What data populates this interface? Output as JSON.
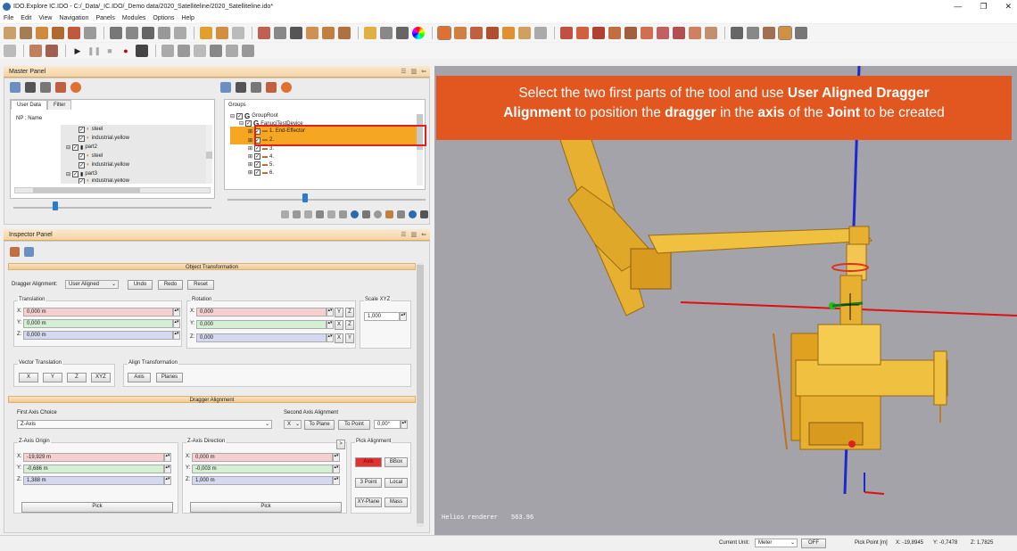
{
  "window": {
    "title": "IDO.Explore IC.IDO - C:/_Data/_IC.IDO/_Demo data/2020_Satelliteline/2020_Satelliteline.ido*",
    "minimize": "—",
    "restore": "❐",
    "close": "✕"
  },
  "menu": [
    "File",
    "Edit",
    "View",
    "Navigation",
    "Panels",
    "Modules",
    "Options",
    "Help"
  ],
  "master_panel": {
    "title": "Master Panel",
    "tabs": [
      "User Data",
      "Filter"
    ],
    "np_label": "NP : Name",
    "tree": [
      {
        "label": "steel"
      },
      {
        "label": "industrial.yellow"
      },
      {
        "label": "part2"
      },
      {
        "label": "steel"
      },
      {
        "label": "industrial.yellow"
      },
      {
        "label": "part3"
      },
      {
        "label": "industrial.yellow"
      }
    ]
  },
  "groups_panel": {
    "title": "Groups",
    "tree": [
      {
        "label": "GroupRoot"
      },
      {
        "label": "FanuciTestDevice"
      },
      {
        "label": "1. End-Effector"
      },
      {
        "label": "2."
      },
      {
        "label": "3."
      },
      {
        "label": "4."
      },
      {
        "label": "5."
      },
      {
        "label": "6."
      }
    ]
  },
  "inspector": {
    "title": "Inspector Panel",
    "object_transformation": "Object Transformation",
    "dragger_alignment_label": "Dragger Alignment:",
    "dragger_alignment_value": "User Aligned",
    "undo": "Undo",
    "redo": "Redo",
    "reset": "Reset",
    "translation": "Translation",
    "rotation": "Rotation",
    "scale_xyz": "Scale XYZ",
    "tx": "0,000 m",
    "ty": "0,000 m",
    "tz": "0,000 m",
    "rx": "0,000",
    "ry": "0,000",
    "rz": "0,000",
    "scale": "1,000",
    "axes": {
      "x": "X:",
      "y": "Y:",
      "z": "Z:"
    },
    "axis_btn": {
      "y": "Y",
      "z": "Z",
      "x": "X"
    },
    "vector_translation": "Vector Translation",
    "vt_buttons": [
      "X",
      "Y",
      "Z",
      "XYZ"
    ],
    "align_transformation": "Align Transformation",
    "at_buttons": [
      "Axis",
      "Planes"
    ],
    "dragger_section": "Dragger Alignment",
    "first_axis_choice": "First Axis Choice",
    "first_axis_value": "Z-Axis",
    "second_axis_alignment": "Second Axis Alignment",
    "second_axis_value": "X",
    "to_plane": "To Plane",
    "to_point": "To Point",
    "angle": "0,00°",
    "z_origin": "Z-Axis Origin",
    "ox": "-19,929 m",
    "oy": "-0,686 m",
    "oz": "1,388 m",
    "z_direction": "Z-Axis Direction",
    "dx": "0,000 m",
    "dy": "-0,003 m",
    "dz": "1,000 m",
    "pick": "Pick",
    "pick_alignment": "Pick Alignment",
    "pa_buttons": [
      "Axis",
      "BBox",
      "3 Point",
      "Local",
      "XY-Plane",
      "Mass"
    ],
    "expand": ">"
  },
  "callout": {
    "p1": "Select the two first parts of the tool and use ",
    "b1": "User Aligned Dragger",
    "b1b": "Alignment",
    "p2": " to position the ",
    "b2": "dragger",
    "p3": " in the ",
    "b3": "axis",
    "p4": " of the ",
    "b4": "Joint",
    "p5": " to be created"
  },
  "viewport": {
    "renderer": "Helios renderer",
    "fps": "563.96"
  },
  "status": {
    "current_unit_label": "Current Unit:",
    "unit": "Meter",
    "off": "OFF",
    "pick_point": "Pick Point [m]",
    "x": "X: -19,8945",
    "y": "Y: -0,7478",
    "z": "Z: 1,7825"
  },
  "colors": {
    "accent": "#e2571f",
    "panel_header": "#f4d3a3",
    "selection": "#e02020",
    "highlight_row": "#f5a623"
  }
}
